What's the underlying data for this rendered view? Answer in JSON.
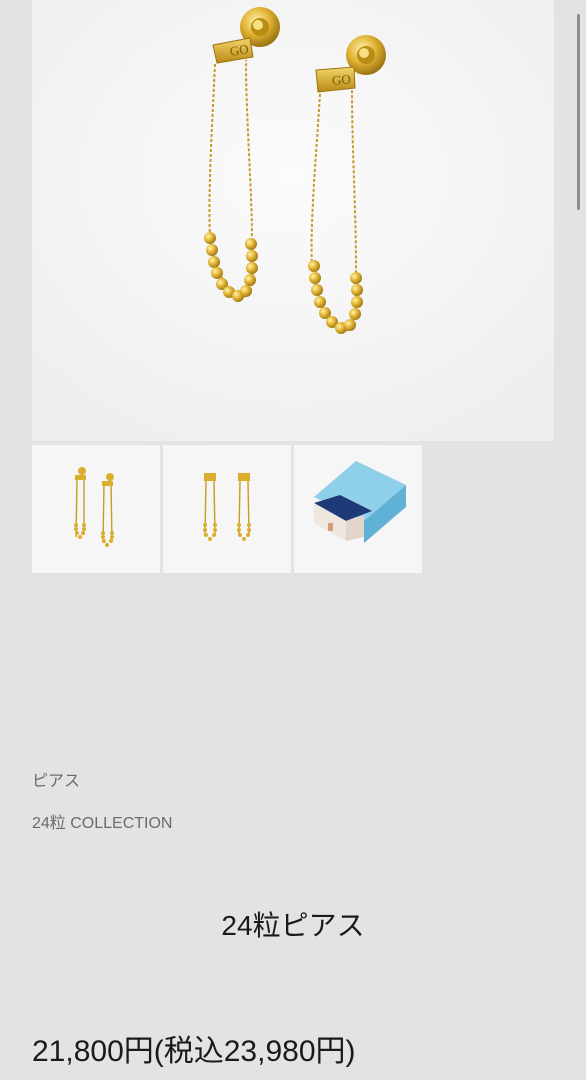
{
  "product": {
    "category": "ピアス",
    "collection": "24粒 COLLECTION",
    "name": "24粒ピアス",
    "price": "21,800円(税込23,980円)",
    "engraving": "GO"
  },
  "gallery": {
    "thumbnails": [
      {
        "subject": "earrings-angled"
      },
      {
        "subject": "earrings-front"
      },
      {
        "subject": "gift-box"
      }
    ]
  },
  "colors": {
    "background": "#e3e3e3",
    "gold": "#d4a72c",
    "box_blue": "#7ec4e0"
  }
}
